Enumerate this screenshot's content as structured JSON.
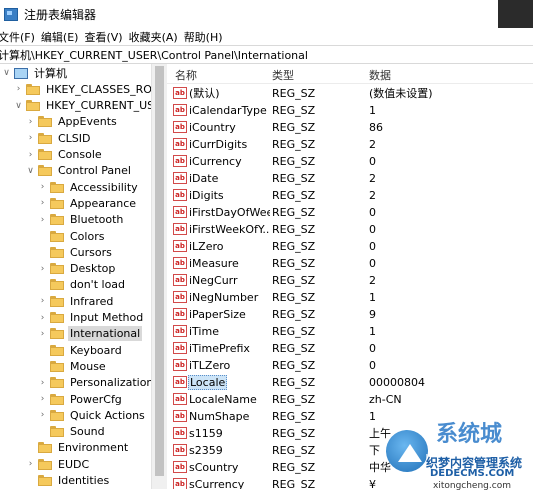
{
  "window": {
    "title": "注册表编辑器"
  },
  "menu": [
    "文件(F)",
    "编辑(E)",
    "查看(V)",
    "收藏夹(A)",
    "帮助(H)"
  ],
  "address": "计算机\\HKEY_CURRENT_USER\\Control Panel\\International",
  "tree": [
    {
      "label": "计算机",
      "level": 0,
      "expander": "v",
      "icon": "computer-icon"
    },
    {
      "label": "HKEY_CLASSES_ROOT",
      "level": 1,
      "expander": ">",
      "icon": "folder-icon"
    },
    {
      "label": "HKEY_CURRENT_USER",
      "level": 1,
      "expander": "v",
      "icon": "folder-icon"
    },
    {
      "label": "AppEvents",
      "level": 2,
      "expander": ">",
      "icon": "folder-icon"
    },
    {
      "label": "CLSID",
      "level": 2,
      "expander": ">",
      "icon": "folder-icon"
    },
    {
      "label": "Console",
      "level": 2,
      "expander": ">",
      "icon": "folder-icon"
    },
    {
      "label": "Control Panel",
      "level": 2,
      "expander": "v",
      "icon": "folder-icon"
    },
    {
      "label": "Accessibility",
      "level": 3,
      "expander": ">",
      "icon": "folder-icon"
    },
    {
      "label": "Appearance",
      "level": 3,
      "expander": ">",
      "icon": "folder-icon"
    },
    {
      "label": "Bluetooth",
      "level": 3,
      "expander": ">",
      "icon": "folder-icon"
    },
    {
      "label": "Colors",
      "level": 3,
      "expander": "",
      "icon": "folder-icon"
    },
    {
      "label": "Cursors",
      "level": 3,
      "expander": "",
      "icon": "folder-icon"
    },
    {
      "label": "Desktop",
      "level": 3,
      "expander": ">",
      "icon": "folder-icon"
    },
    {
      "label": "don't load",
      "level": 3,
      "expander": "",
      "icon": "folder-icon"
    },
    {
      "label": "Infrared",
      "level": 3,
      "expander": ">",
      "icon": "folder-icon"
    },
    {
      "label": "Input Method",
      "level": 3,
      "expander": ">",
      "icon": "folder-icon"
    },
    {
      "label": "International",
      "level": 3,
      "expander": ">",
      "icon": "folder-icon",
      "selected": true
    },
    {
      "label": "Keyboard",
      "level": 3,
      "expander": "",
      "icon": "folder-icon"
    },
    {
      "label": "Mouse",
      "level": 3,
      "expander": "",
      "icon": "folder-icon"
    },
    {
      "label": "Personalization",
      "level": 3,
      "expander": ">",
      "icon": "folder-icon"
    },
    {
      "label": "PowerCfg",
      "level": 3,
      "expander": ">",
      "icon": "folder-icon"
    },
    {
      "label": "Quick Actions",
      "level": 3,
      "expander": ">",
      "icon": "folder-icon"
    },
    {
      "label": "Sound",
      "level": 3,
      "expander": "",
      "icon": "folder-icon"
    },
    {
      "label": "Environment",
      "level": 2,
      "expander": "",
      "icon": "folder-icon"
    },
    {
      "label": "EUDC",
      "level": 2,
      "expander": ">",
      "icon": "folder-icon"
    },
    {
      "label": "Identities",
      "level": 2,
      "expander": "",
      "icon": "folder-icon"
    }
  ],
  "columns": {
    "name": "名称",
    "type": "类型",
    "data": "数据"
  },
  "values": [
    {
      "name": "(默认)",
      "type": "REG_SZ",
      "data": "(数值未设置)"
    },
    {
      "name": "iCalendarType",
      "type": "REG_SZ",
      "data": "1"
    },
    {
      "name": "iCountry",
      "type": "REG_SZ",
      "data": "86"
    },
    {
      "name": "iCurrDigits",
      "type": "REG_SZ",
      "data": "2"
    },
    {
      "name": "iCurrency",
      "type": "REG_SZ",
      "data": "0"
    },
    {
      "name": "iDate",
      "type": "REG_SZ",
      "data": "2"
    },
    {
      "name": "iDigits",
      "type": "REG_SZ",
      "data": "2"
    },
    {
      "name": "iFirstDayOfWeek",
      "type": "REG_SZ",
      "data": "0"
    },
    {
      "name": "iFirstWeekOfY...",
      "type": "REG_SZ",
      "data": "0"
    },
    {
      "name": "iLZero",
      "type": "REG_SZ",
      "data": "0"
    },
    {
      "name": "iMeasure",
      "type": "REG_SZ",
      "data": "0"
    },
    {
      "name": "iNegCurr",
      "type": "REG_SZ",
      "data": "2"
    },
    {
      "name": "iNegNumber",
      "type": "REG_SZ",
      "data": "1"
    },
    {
      "name": "iPaperSize",
      "type": "REG_SZ",
      "data": "9"
    },
    {
      "name": "iTime",
      "type": "REG_SZ",
      "data": "1"
    },
    {
      "name": "iTimePrefix",
      "type": "REG_SZ",
      "data": "0"
    },
    {
      "name": "iTLZero",
      "type": "REG_SZ",
      "data": "0"
    },
    {
      "name": "Locale",
      "type": "REG_SZ",
      "data": "00000804",
      "selected": true
    },
    {
      "name": "LocaleName",
      "type": "REG_SZ",
      "data": "zh-CN"
    },
    {
      "name": "NumShape",
      "type": "REG_SZ",
      "data": "1"
    },
    {
      "name": "s1159",
      "type": "REG_SZ",
      "data": "上午"
    },
    {
      "name": "s2359",
      "type": "REG_SZ",
      "data": "下"
    },
    {
      "name": "sCountry",
      "type": "REG_SZ",
      "data": "中华"
    },
    {
      "name": "sCurrency",
      "type": "REG_SZ",
      "data": "¥"
    }
  ],
  "value_icon": "ab",
  "watermark": {
    "top": "系统城",
    "mid": "织梦内容管理系统",
    "bot": "DEDECMS.COM",
    "url": "xitongcheng.com"
  }
}
